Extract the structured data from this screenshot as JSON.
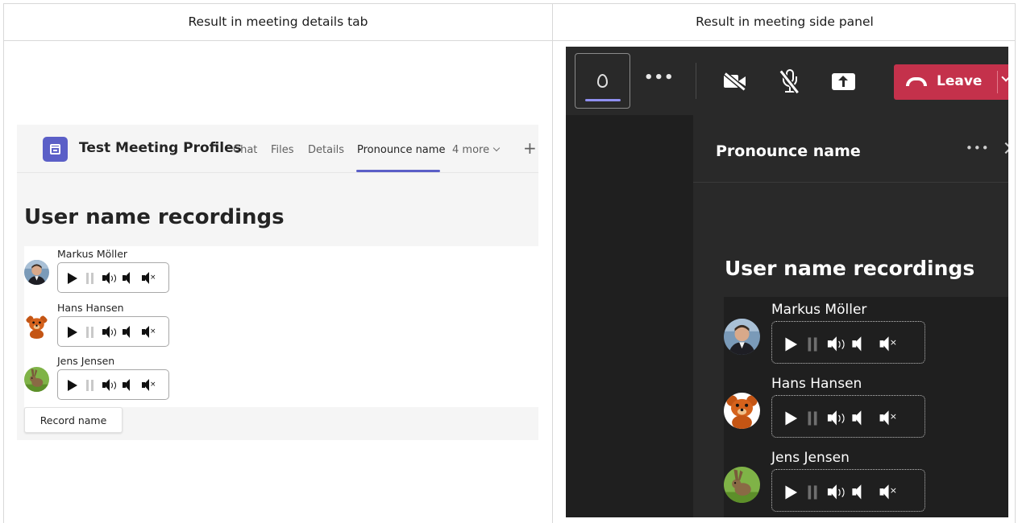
{
  "columns": {
    "left_header": "Result in meeting details tab",
    "right_header": "Result in meeting side panel"
  },
  "details_tab": {
    "meeting_title": "Test Meeting Profiles",
    "tabs": [
      {
        "label": "Chat"
      },
      {
        "label": "Files"
      },
      {
        "label": "Details"
      },
      {
        "label": "Pronounce name"
      },
      {
        "label": "4 more"
      }
    ],
    "active_tab": "Pronounce name",
    "heading": "User name recordings",
    "record_button": "Record name"
  },
  "users": [
    {
      "name": "Markus Möller",
      "avatar": "man-photo"
    },
    {
      "name": "Hans Hansen",
      "avatar": "teddy-bear"
    },
    {
      "name": "Jens Jensen",
      "avatar": "hare"
    }
  ],
  "player_icons": [
    "play-icon",
    "pause-icon",
    "volume-up-icon",
    "volume-down-icon",
    "mute-icon"
  ],
  "side_panel": {
    "leave_label": "Leave",
    "panel_title": "Pronounce name",
    "heading": "User name recordings"
  },
  "colors": {
    "teams_purple": "#5b5fc7",
    "leave_red": "#c4314b",
    "dark_bg": "#1f1f1f",
    "panel_bg": "#292929"
  }
}
